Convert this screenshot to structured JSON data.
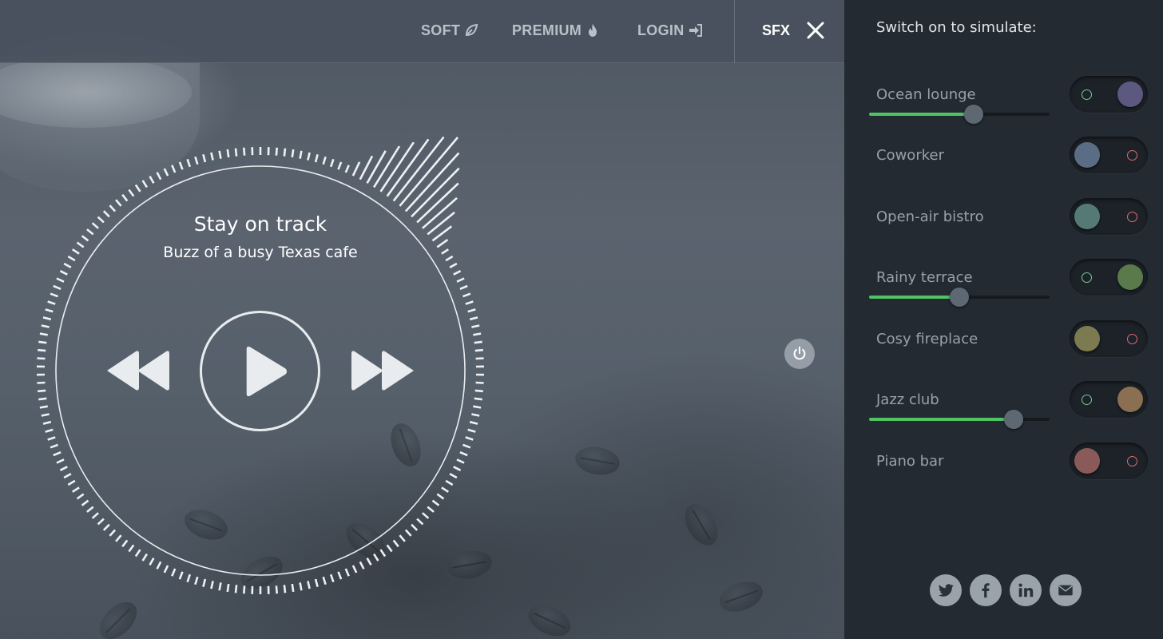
{
  "nav": {
    "items": [
      {
        "label": "SOFT",
        "icon": "leaf-icon"
      },
      {
        "label": "PREMIUM",
        "icon": "flame-icon"
      },
      {
        "label": "LOGIN",
        "icon": "login-icon"
      }
    ],
    "sfx_label": "SFX",
    "close_icon": "close-icon"
  },
  "player": {
    "title": "Stay on track",
    "subtitle": "Buzz of a busy Texas cafe",
    "controls": [
      "rewind-icon",
      "play-icon",
      "fast-forward-icon"
    ],
    "power_icon": "power-icon"
  },
  "panel": {
    "heading": "Switch on to simulate:",
    "sounds": [
      {
        "label": "Ocean lounge",
        "on": true,
        "knob_color": "#5d5880",
        "volume": 0.58
      },
      {
        "label": "Coworker",
        "on": false,
        "knob_color": "#5a6d85"
      },
      {
        "label": "Open-air bistro",
        "on": false,
        "knob_color": "#557a76"
      },
      {
        "label": "Rainy terrace",
        "on": true,
        "knob_color": "#5a7a4c",
        "volume": 0.5
      },
      {
        "label": "Cosy fireplace",
        "on": false,
        "knob_color": "#7b7a50"
      },
      {
        "label": "Jazz club",
        "on": true,
        "knob_color": "#8a6f52",
        "volume": 0.8
      },
      {
        "label": "Piano bar",
        "on": false,
        "knob_color": "#8a5a5a"
      }
    ],
    "social": [
      "twitter-icon",
      "facebook-icon",
      "linkedin-icon",
      "email-icon"
    ]
  },
  "colors": {
    "accent_green": "#4fc363",
    "on_indicator": "#79c98d",
    "off_indicator": "#e06a72",
    "panel_bg": "#232a31"
  }
}
